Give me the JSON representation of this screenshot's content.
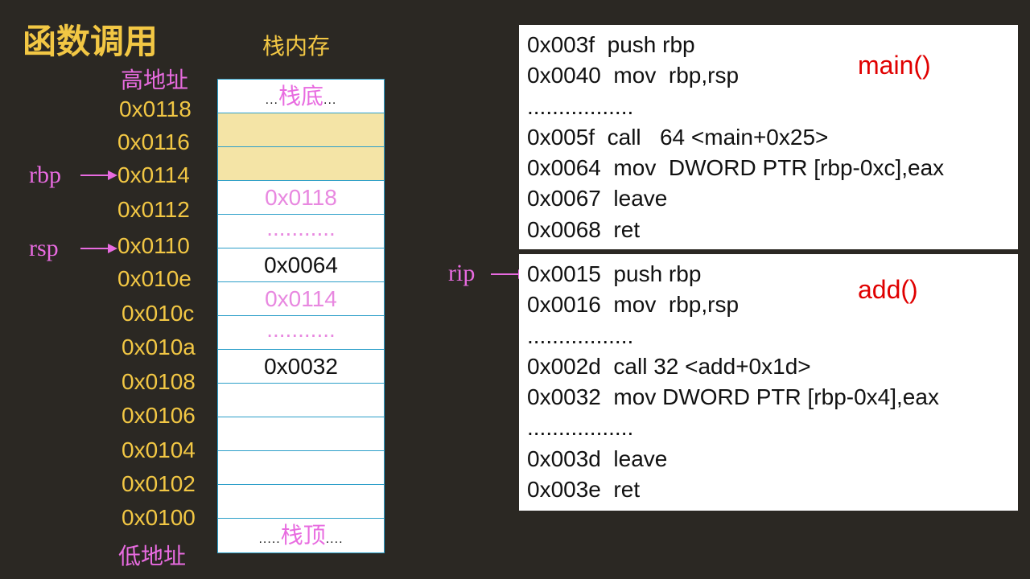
{
  "header": {
    "title": "函数调用",
    "stack_title": "栈内存",
    "high_addr": "高地址",
    "low_addr": "低地址"
  },
  "addresses": [
    "0x0118",
    "0x0116",
    "0x0114",
    "0x0112",
    "0x0110",
    "0x010e",
    "0x010c",
    "0x010a",
    "0x0108",
    "0x0106",
    "0x0104",
    "0x0102",
    "0x0100"
  ],
  "registers": {
    "rbp": "rbp",
    "rsp": "rsp",
    "rip": "rip"
  },
  "stack": {
    "bottom_dots_left": "...",
    "bottom_label": "栈底",
    "bottom_dots_right": "...",
    "top_dots_left": ".....",
    "top_label": "栈顶",
    "top_dots_right": "....",
    "cells": [
      "0x0118",
      "...........",
      "0x0064",
      "0x0114",
      "...........",
      "0x0032"
    ]
  },
  "main_block": {
    "label": "main()",
    "lines": [
      "0x003f  push rbp",
      "0x0040  mov  rbp,rsp",
      ".................",
      "0x005f  call   64 <main+0x25>",
      "0x0064  mov  DWORD PTR [rbp-0xc],eax",
      "0x0067  leave",
      "0x0068  ret"
    ]
  },
  "add_block": {
    "label": "add()",
    "lines": [
      "0x0015  push rbp",
      "0x0016  mov  rbp,rsp",
      ".................",
      "0x002d  call 32 <add+0x1d>",
      "0x0032  mov DWORD PTR [rbp-0x4],eax",
      ".................",
      "0x003d  leave",
      "0x003e  ret"
    ]
  },
  "colors": {
    "background": "#2b2823",
    "gold": "#f2c744",
    "pink": "#e86be0",
    "highlight": "#f4e4a6",
    "cell_border": "#2c9fc9",
    "func_label": "#e00000"
  }
}
